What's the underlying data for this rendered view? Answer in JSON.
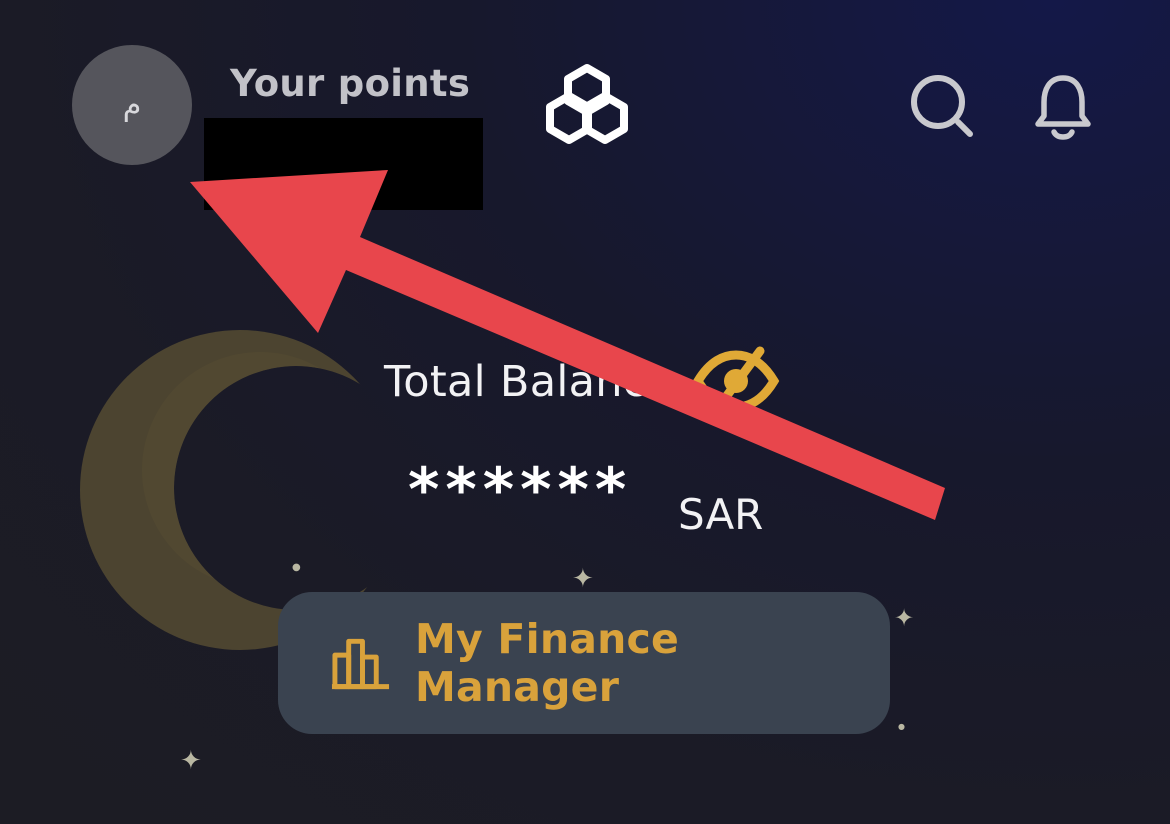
{
  "header": {
    "avatar_initial": "م",
    "points_label": "Your points",
    "points_value": "",
    "logo_icon": "triple-ring-logo-icon",
    "search_icon": "search-icon",
    "notifications_icon": "bell-icon"
  },
  "balance": {
    "label": "Total Balance",
    "visibility_icon": "eye-slash-icon",
    "value": "******",
    "currency": "SAR"
  },
  "finance_manager": {
    "label": "My Finance Manager",
    "icon": "bar-chart-icon"
  },
  "decor": {
    "moon_icon": "crescent-moon-icon",
    "star_icon": "sparkle-star-icon"
  },
  "annotation": {
    "arrow_color": "#e8464c"
  },
  "colors": {
    "accent_gold": "#d9a23b",
    "button_bg": "#3a4350",
    "avatar_bg": "#55555c"
  }
}
